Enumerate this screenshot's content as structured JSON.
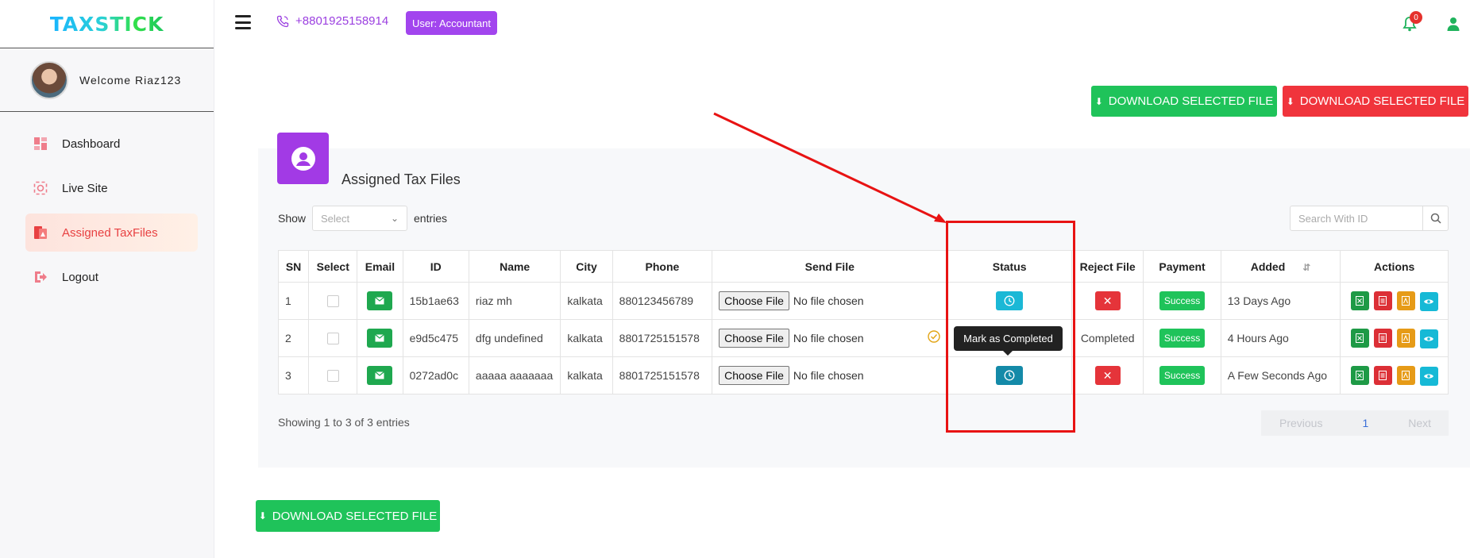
{
  "brand": {
    "logo_text": "TAXSTICK"
  },
  "sidebar": {
    "welcome": "Welcome Riaz123",
    "items": [
      {
        "label": "Dashboard",
        "icon": "dashboard-icon",
        "active": false
      },
      {
        "label": "Live Site",
        "icon": "live-site-icon",
        "active": false
      },
      {
        "label": "Assigned TaxFiles",
        "icon": "taxfiles-icon",
        "active": true
      },
      {
        "label": "Logout",
        "icon": "logout-icon",
        "active": false
      }
    ]
  },
  "header": {
    "phone": "+8801925158914",
    "user_label": "User:  Accountant",
    "notification_count": "0"
  },
  "buttons": {
    "download_green_top": "DOWNLOAD SELECTED FILE",
    "download_red_top": "DOWNLOAD SELECTED FILE",
    "download_green_bottom": "DOWNLOAD SELECTED FILE"
  },
  "card": {
    "title": "Assigned Tax Files",
    "show_label": "Show",
    "select_placeholder": "Select",
    "entries_label": "entries",
    "search_placeholder": "Search With ID"
  },
  "table": {
    "headers": [
      "SN",
      "Select",
      "Email",
      "ID",
      "Name",
      "City",
      "Phone",
      "Send File",
      "Status",
      "Reject File",
      "Payment",
      "Added",
      "Actions"
    ],
    "choose_file_label": "Choose File",
    "no_file_label": "No file chosen",
    "rows": [
      {
        "sn": "1",
        "id": "15b1ae63",
        "name": "riaz mh",
        "city": "kalkata",
        "phone": "880123456789",
        "reject": "",
        "payment": "Success",
        "added": "13 Days Ago"
      },
      {
        "sn": "2",
        "id": "e9d5c475",
        "name": "dfg undefined",
        "city": "kalkata",
        "phone": "8801725151578",
        "reject": "Completed",
        "payment": "Success",
        "added": "4 Hours Ago"
      },
      {
        "sn": "3",
        "id": "0272ad0c",
        "name": "aaaaa aaaaaaa",
        "city": "kalkata",
        "phone": "8801725151578",
        "reject": "",
        "payment": "Success",
        "added": "A Few Seconds Ago"
      }
    ],
    "tooltip": "Mark as Completed"
  },
  "footer": {
    "showing": "Showing 1 to 3 of 3 entries",
    "previous": "Previous",
    "page": "1",
    "next": "Next"
  },
  "colors": {
    "accent_purple": "#a245ee",
    "success_green": "#1fc35a",
    "danger_red": "#f0343c",
    "annotation_red": "#e81313"
  }
}
